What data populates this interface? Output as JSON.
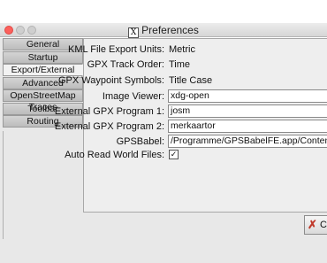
{
  "window": {
    "title": "Preferences",
    "title_icon": "x11-icon"
  },
  "tabs": [
    {
      "label": "General",
      "active": false
    },
    {
      "label": "Startup",
      "active": false
    },
    {
      "label": "Export/External",
      "active": true
    },
    {
      "label": "Advanced",
      "active": false
    },
    {
      "label": "OpenStreetMap Traces",
      "active": false
    },
    {
      "label": "Toolbar",
      "active": false
    },
    {
      "label": "Routing",
      "active": false
    }
  ],
  "settings": {
    "kml_units": {
      "label": "KML File Export Units:",
      "value": "Metric"
    },
    "gpx_track_order": {
      "label": "GPX Track Order:",
      "value": "Time"
    },
    "gpx_waypoint_symbols": {
      "label": "GPX Waypoint Symbols:",
      "value": "Title Case"
    },
    "image_viewer": {
      "label": "Image Viewer:",
      "value": "xdg-open"
    },
    "external_gpx_1": {
      "label": "External GPX Program 1:",
      "value": "josm"
    },
    "external_gpx_2": {
      "label": "External GPX Program 2:",
      "value": "merkaartor"
    },
    "gpsbabel": {
      "label": "GPSBabel:",
      "value": "/Programme/GPSBabelFE.app/Contents/MacOS/gpsbabel"
    },
    "auto_read_world": {
      "label": "Auto Read World Files:",
      "checked": true,
      "mark": "✓"
    }
  },
  "buttons": {
    "close_label": "C",
    "close_icon": "✗"
  },
  "colors": {
    "close_red": "#fc605c",
    "panel_bg": "#eeeeee",
    "tab_active_bg": "#f2f2f2"
  }
}
